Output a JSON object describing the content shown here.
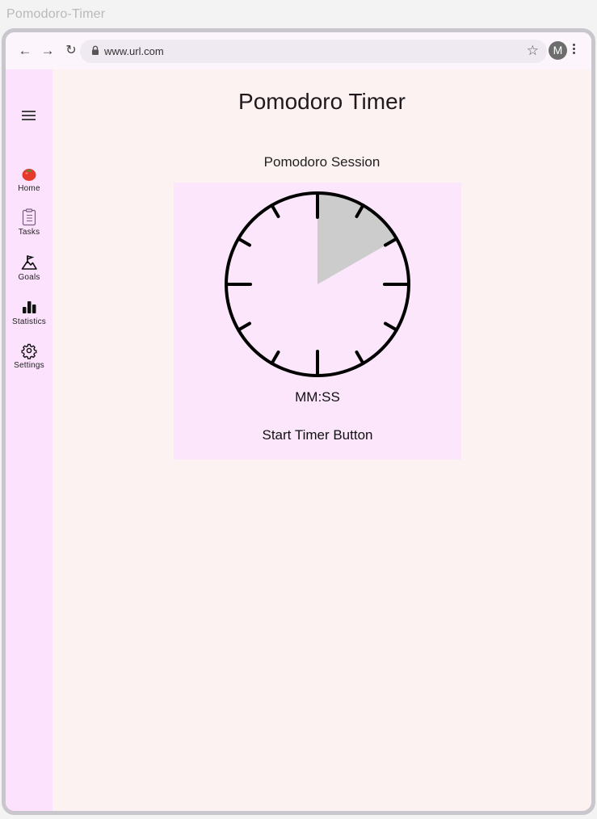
{
  "window": {
    "title": "Pomodoro-Timer"
  },
  "browser": {
    "url": "www.url.com",
    "avatar_initial": "M",
    "icons": [
      "back-arrow-icon",
      "forward-arrow-icon",
      "reload-icon",
      "lock-icon",
      "star-icon",
      "kebab-menu-icon"
    ]
  },
  "sidebar": {
    "menu_icon": "hamburger-icon",
    "items": [
      {
        "label": "Home",
        "icon": "tomato-icon"
      },
      {
        "label": "Tasks",
        "icon": "clipboard-icon"
      },
      {
        "label": "Goals",
        "icon": "mountain-flag-icon"
      },
      {
        "label": "Statistics",
        "icon": "bar-chart-icon"
      },
      {
        "label": "Settings",
        "icon": "gear-icon"
      }
    ]
  },
  "main": {
    "title": "Pomodoro Timer",
    "session_label": "Pomodoro Session",
    "timer": {
      "time": "MM:SS",
      "start_label": "Start Timer Button",
      "elapsed_fraction": 0.167
    }
  },
  "colors": {
    "sidebar_bg": "#fde2fd",
    "page_bg": "#fdf2f2",
    "card_bg": "#fbe6fb",
    "clock_fill": "#cccccc",
    "tomato": "#e53a2a"
  }
}
